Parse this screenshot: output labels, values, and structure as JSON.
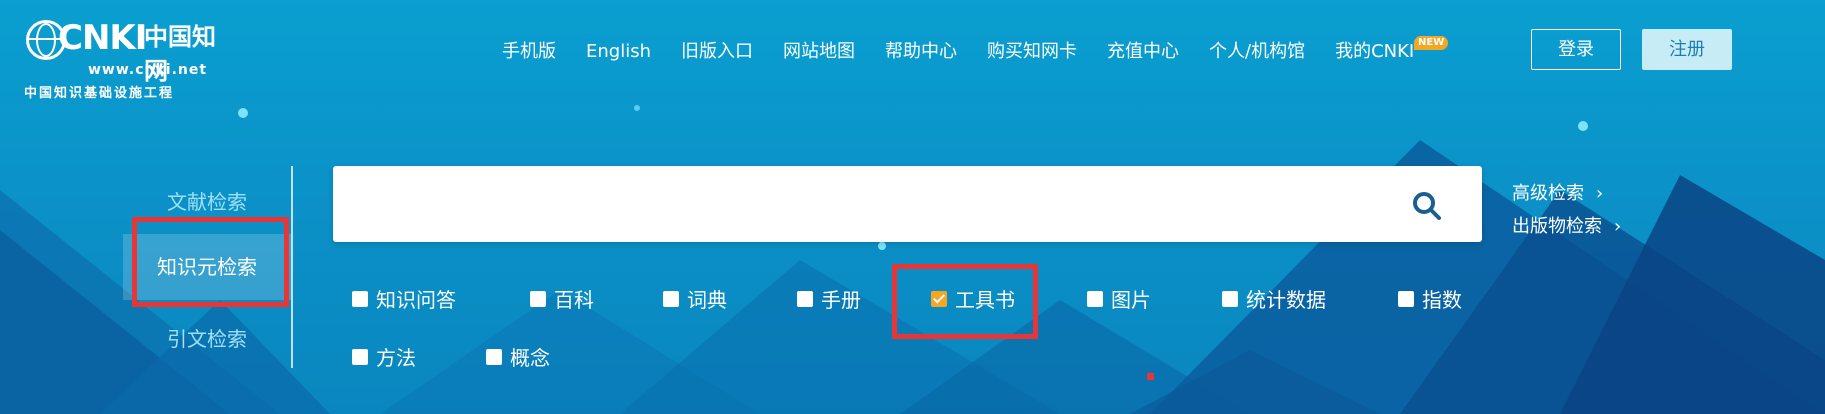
{
  "logo": {
    "brand": "CNKI",
    "cn_name": "中国知网",
    "url": "www.cnki.net",
    "subtitle": "中国知识基础设施工程"
  },
  "nav": {
    "items": [
      "手机版",
      "English",
      "旧版入口",
      "网站地图",
      "帮助中心",
      "购买知网卡",
      "充值中心",
      "个人/机构馆",
      "我的CNKI"
    ],
    "new_badge": "NEW"
  },
  "auth": {
    "login": "登录",
    "register": "注册"
  },
  "search_tabs": [
    {
      "label": "文献检索"
    },
    {
      "label": "知识元检索",
      "active": true
    },
    {
      "label": "引文检索"
    }
  ],
  "search": {
    "value": "",
    "placeholder": ""
  },
  "side_links": {
    "advanced": "高级检索",
    "publication": "出版物检索"
  },
  "categories": [
    {
      "label": "知识问答",
      "checked": false
    },
    {
      "label": "百科",
      "checked": false
    },
    {
      "label": "词典",
      "checked": false
    },
    {
      "label": "手册",
      "checked": false
    },
    {
      "label": "工具书",
      "checked": true
    },
    {
      "label": "图片",
      "checked": false
    },
    {
      "label": "统计数据",
      "checked": false
    },
    {
      "label": "指数",
      "checked": false
    },
    {
      "label": "方法",
      "checked": false
    },
    {
      "label": "概念",
      "checked": false
    }
  ],
  "colors": {
    "background": "#0a9fd0",
    "highlight_red": "#e93535",
    "checkbox_checked": "#f5a623",
    "register_bg": "#c8ecf6",
    "search_icon": "#1b5f8f"
  },
  "icons": {
    "search": "search-icon",
    "chevron": "chevron-right-icon",
    "globe": "globe-icon"
  }
}
